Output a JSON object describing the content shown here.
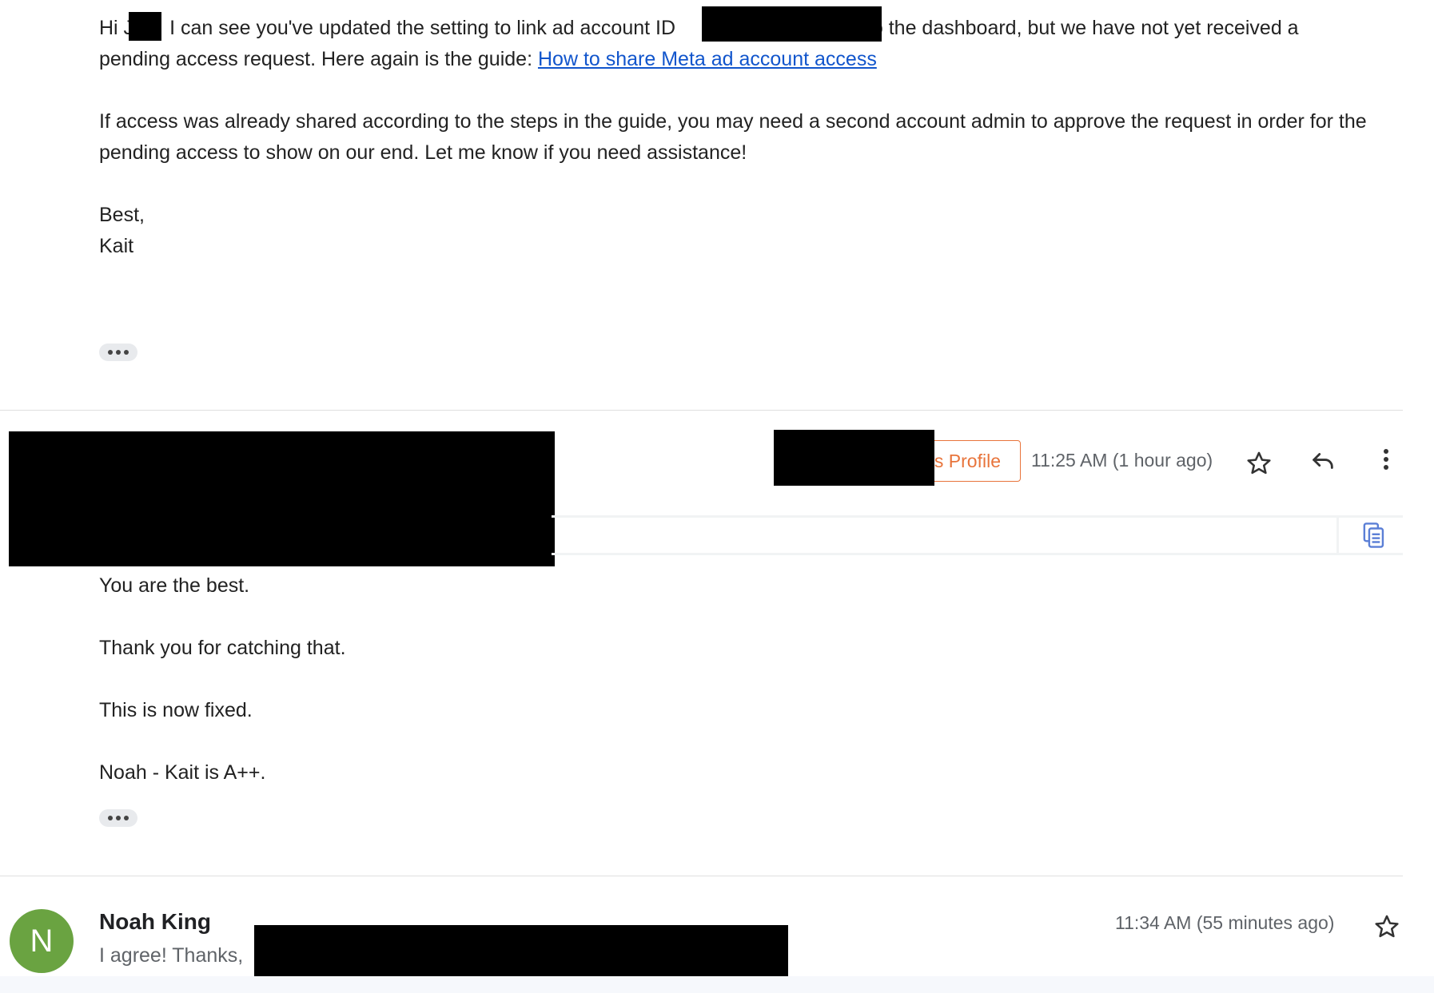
{
  "message1": {
    "greeting": "Hi J",
    "line1_a": "I can see you've updated the setting to link ad account ID",
    "line1_b": "to the dashboard, but we have not yet received a",
    "line2": "pending access request. Here again is the guide:",
    "guide_link": "How to share Meta ad account access",
    "para2": "If access was already shared according to the steps in the guide, you may need a second account admin to approve the request in order for the pending access to show on our end. Let me know if you need assistance!",
    "signoff": "Best,",
    "signature": "Kait"
  },
  "message2": {
    "profile_chip": "s Profile",
    "time": "11:25 AM (1 hour ago)",
    "lines": [
      "You are the best.",
      "Thank you for catching that.",
      "This is now fixed.",
      "Noah - Kait is A++."
    ]
  },
  "message3": {
    "avatar_letter": "N",
    "sender": "Noah King",
    "snippet": "I agree! Thanks,",
    "time": "11:34 AM (55 minutes ago)"
  },
  "icons": {
    "star": "star-icon",
    "reply": "reply-icon",
    "more": "more-vert-icon",
    "copy": "copy-icon",
    "ellipsis": "show-trimmed-content-icon"
  },
  "colors": {
    "link": "#1155cc",
    "profile_chip": "#e8743b",
    "avatar": "#6aa341"
  }
}
